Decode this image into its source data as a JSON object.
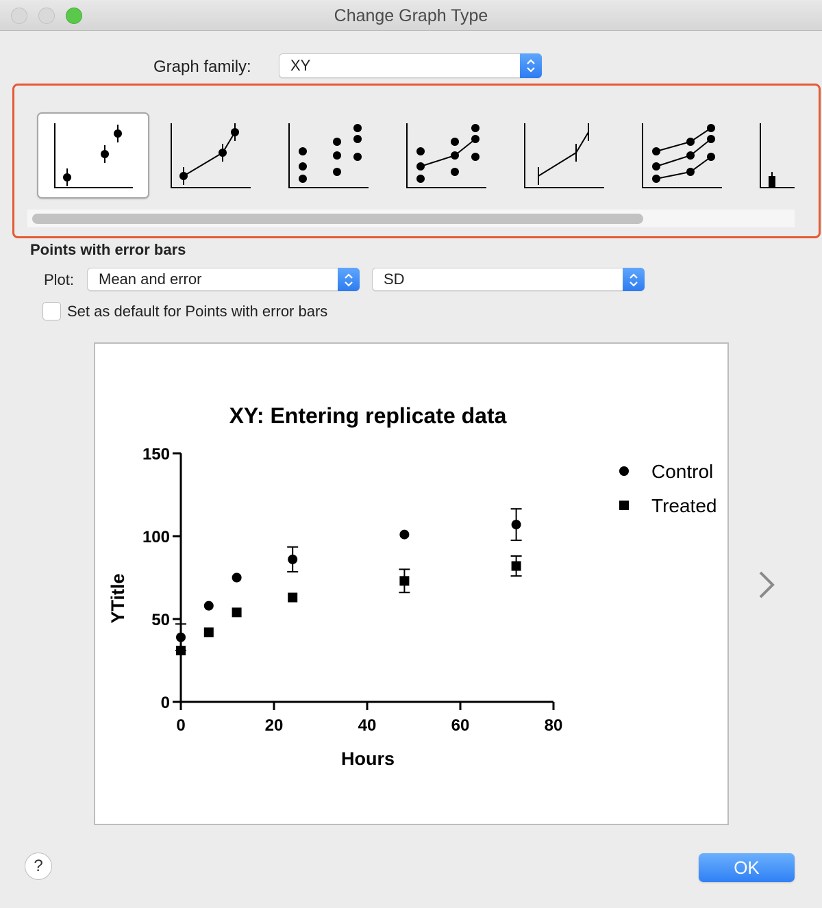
{
  "window": {
    "title": "Change Graph Type"
  },
  "graph_family": {
    "label": "Graph family:",
    "value": "XY"
  },
  "gallery": {
    "items": [
      {
        "name": "points-with-error-bars",
        "selected": true
      },
      {
        "name": "points-connected-with-error-bars",
        "selected": false
      },
      {
        "name": "each-replicate-points",
        "selected": false
      },
      {
        "name": "each-replicate-connected-mean",
        "selected": false
      },
      {
        "name": "line-with-error-bars",
        "selected": false
      },
      {
        "name": "each-replicate-connected-lines",
        "selected": false
      },
      {
        "name": "bar-partial",
        "selected": false
      }
    ]
  },
  "section": {
    "title": "Points with error bars"
  },
  "plot": {
    "label": "Plot:",
    "value": "Mean and error",
    "error_value": "SD"
  },
  "default_checkbox": {
    "label": "Set as default for Points with error bars",
    "checked": false
  },
  "buttons": {
    "help": "?",
    "ok": "OK"
  },
  "colors": {
    "accent": "#2f80f5",
    "highlight_frame": "#e45a33"
  },
  "chart_data": {
    "type": "scatter",
    "title": "XY: Entering replicate data",
    "xlabel": "Hours",
    "ylabel": "YTitle",
    "xlim": [
      0,
      80
    ],
    "ylim": [
      0,
      150
    ],
    "xticks": [
      0,
      20,
      40,
      60,
      80
    ],
    "yticks": [
      0,
      50,
      100,
      150
    ],
    "legend_position": "top-right",
    "series": [
      {
        "name": "Control",
        "marker": "circle",
        "x": [
          0,
          6,
          12,
          24,
          48,
          72
        ],
        "y": [
          39,
          58,
          75,
          86,
          101,
          107
        ],
        "err": [
          8,
          0,
          0,
          7.5,
          0,
          9.5
        ]
      },
      {
        "name": "Treated",
        "marker": "square",
        "x": [
          0,
          6,
          12,
          24,
          48,
          72
        ],
        "y": [
          31,
          42,
          54,
          63,
          73,
          82
        ],
        "err": [
          0,
          0,
          0,
          0,
          7,
          6
        ]
      }
    ]
  }
}
